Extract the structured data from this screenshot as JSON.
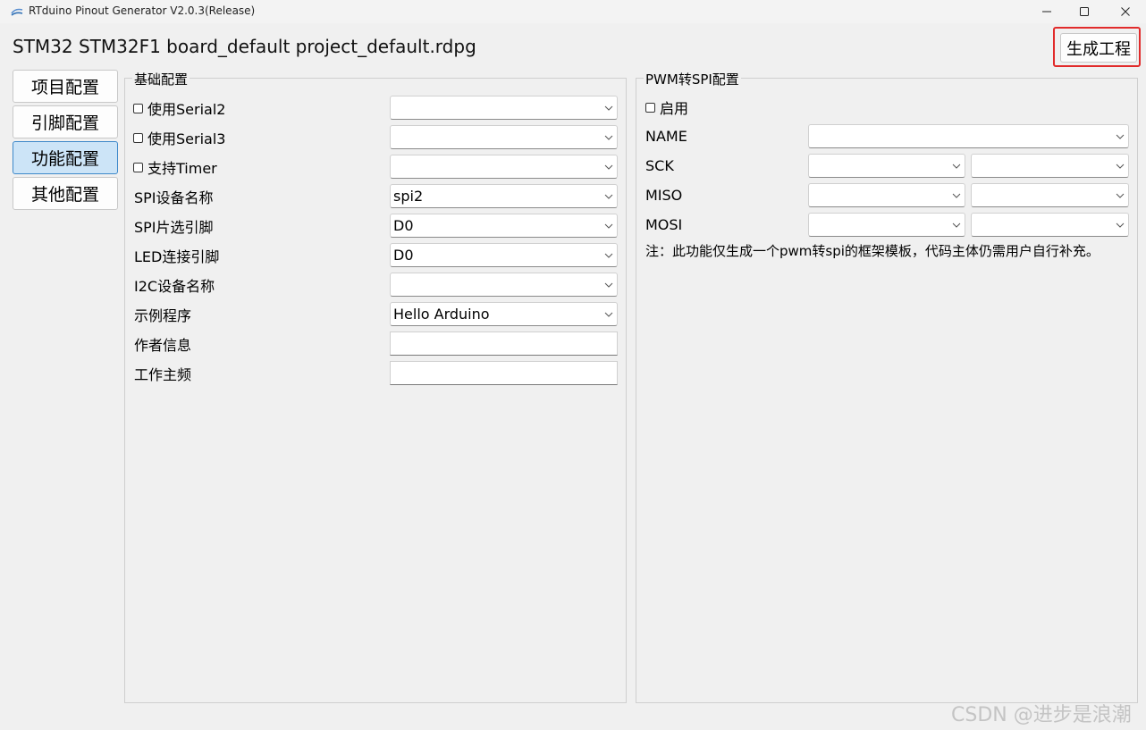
{
  "window": {
    "title": "RTduino Pinout Generator V2.0.3(Release)",
    "icons": {
      "app": "app-icon",
      "minimize": "minimize-icon",
      "maximize": "maximize-icon",
      "close": "close-icon"
    }
  },
  "header": {
    "project_title": "STM32 STM32F1 board_default project_default.rdpg",
    "generate_button": "生成工程",
    "highlight_color": "#e12b2b"
  },
  "nav": {
    "items": [
      {
        "label": "项目配置",
        "active": false
      },
      {
        "label": "引脚配置",
        "active": false
      },
      {
        "label": "功能配置",
        "active": true
      },
      {
        "label": "其他配置",
        "active": false
      }
    ],
    "active_color": "#cce4f7"
  },
  "basic": {
    "title": "基础配置",
    "rows": [
      {
        "label": "使用Serial2",
        "checkbox": true,
        "value": ""
      },
      {
        "label": "使用Serial3",
        "checkbox": true,
        "value": ""
      },
      {
        "label": "支持Timer",
        "checkbox": true,
        "value": ""
      },
      {
        "label": "SPI设备名称",
        "value": "spi2"
      },
      {
        "label": "SPI片选引脚",
        "value": "D0"
      },
      {
        "label": "LED连接引脚",
        "value": "D0"
      },
      {
        "label": "I2C设备名称",
        "value": ""
      },
      {
        "label": "示例程序",
        "value": "Hello Arduino"
      },
      {
        "label": "作者信息",
        "value": ""
      },
      {
        "label": "工作主频",
        "value": ""
      }
    ]
  },
  "pwm": {
    "title": "PWM转SPI配置",
    "enable_label": "启用",
    "name_label": "NAME",
    "name_value": "",
    "sck_label": "SCK",
    "miso_label": "MISO",
    "mosi_label": "MOSI",
    "note": "注：此功能仅生成一个pwm转spi的框架模板，代码主体仍需用户自行补充。"
  },
  "watermark": "CSDN @进步是浪潮"
}
